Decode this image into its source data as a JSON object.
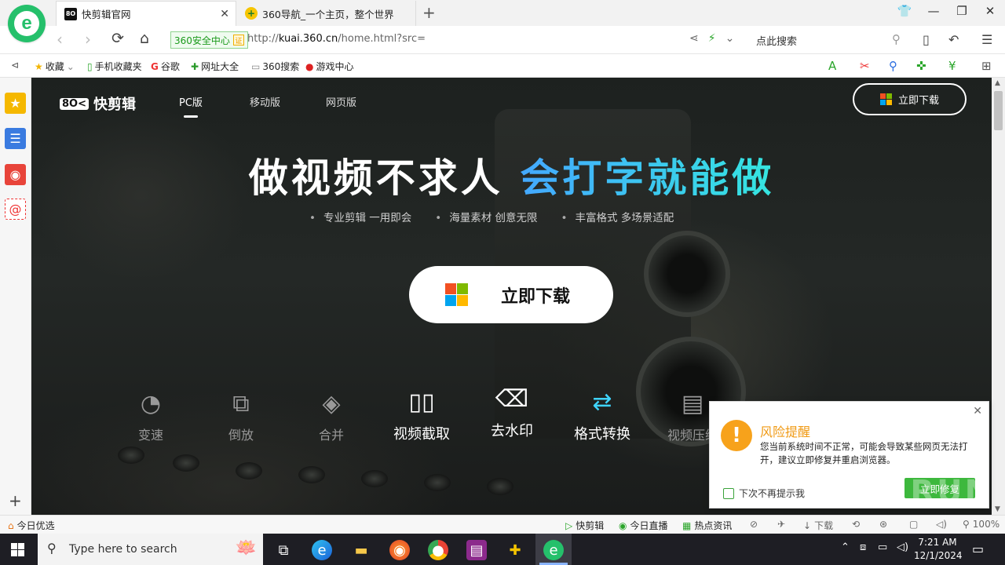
{
  "browser": {
    "tabs": [
      {
        "label": "快剪辑官网",
        "favicon": "kuai-logo-icon",
        "active": true
      },
      {
        "label": "360导航_一个主页，整个世界",
        "favicon": "360-nav-icon",
        "active": false
      }
    ],
    "safe_badge": "360安全中心",
    "url_prefix": "http://",
    "url_host": "kuai.360.cn",
    "url_path": "/home.html?src=",
    "search_placeholder": "点此搜索"
  },
  "bookmarks": [
    {
      "label": "收藏",
      "icon": "star-icon"
    },
    {
      "label": "手机收藏夹",
      "icon": "phone-icon"
    },
    {
      "label": "谷歌",
      "icon": "google-icon"
    },
    {
      "label": "网址大全",
      "icon": "nav-globe-icon"
    },
    {
      "label": "360搜索",
      "icon": "page-icon"
    },
    {
      "label": "游戏中心",
      "icon": "game-icon"
    }
  ],
  "site": {
    "logo_mark": "8O<",
    "logo_text": "快剪辑",
    "nav": [
      {
        "label": "PC版",
        "active": true
      },
      {
        "label": "移动版",
        "active": false
      },
      {
        "label": "网页版",
        "active": false
      }
    ],
    "top_download": "立即下载",
    "headline_white": "做视频不求人",
    "headline_blue": "会打字就能做",
    "subtitles": [
      "专业剪辑 一用即会",
      "海量素材 创意无限",
      "丰富格式 多场景适配"
    ],
    "big_download": "立即下载",
    "features": [
      {
        "label": "变速",
        "icon": "speed-gauge-icon",
        "bright": false
      },
      {
        "label": "倒放",
        "icon": "reverse-play-icon",
        "bright": false
      },
      {
        "label": "合并",
        "icon": "merge-icon",
        "bright": false
      },
      {
        "label": "视频截取",
        "icon": "clip-icon",
        "bright": true
      },
      {
        "label": "去水印",
        "icon": "eraser-icon",
        "bright": true
      },
      {
        "label": "格式转换",
        "icon": "format-convert-icon",
        "bright": true
      },
      {
        "label": "视频压缩",
        "icon": "compress-icon",
        "bright": false
      }
    ]
  },
  "popup": {
    "title": "风险提醒",
    "body": "您当前系统时间不正常，可能会导致某些网页无法打开，建议立即修复并重启浏览器。",
    "checkbox_label": "下次不再提示我",
    "fix_button": "立即修复"
  },
  "statusbar": {
    "left": "今日优选",
    "items": [
      "快剪辑",
      "今日直播",
      "热点资讯"
    ],
    "download": "下载",
    "zoom": "100%"
  },
  "taskbar": {
    "search_placeholder": "Type here to search",
    "time": "7:21 AM",
    "date": "12/1/2024"
  },
  "watermark": "ANY RUN",
  "colors": {
    "accent_green": "#25c06b",
    "headline_blue": "#3fd4ff",
    "warning_orange": "#f7a21b",
    "fix_green": "#3db83d"
  }
}
